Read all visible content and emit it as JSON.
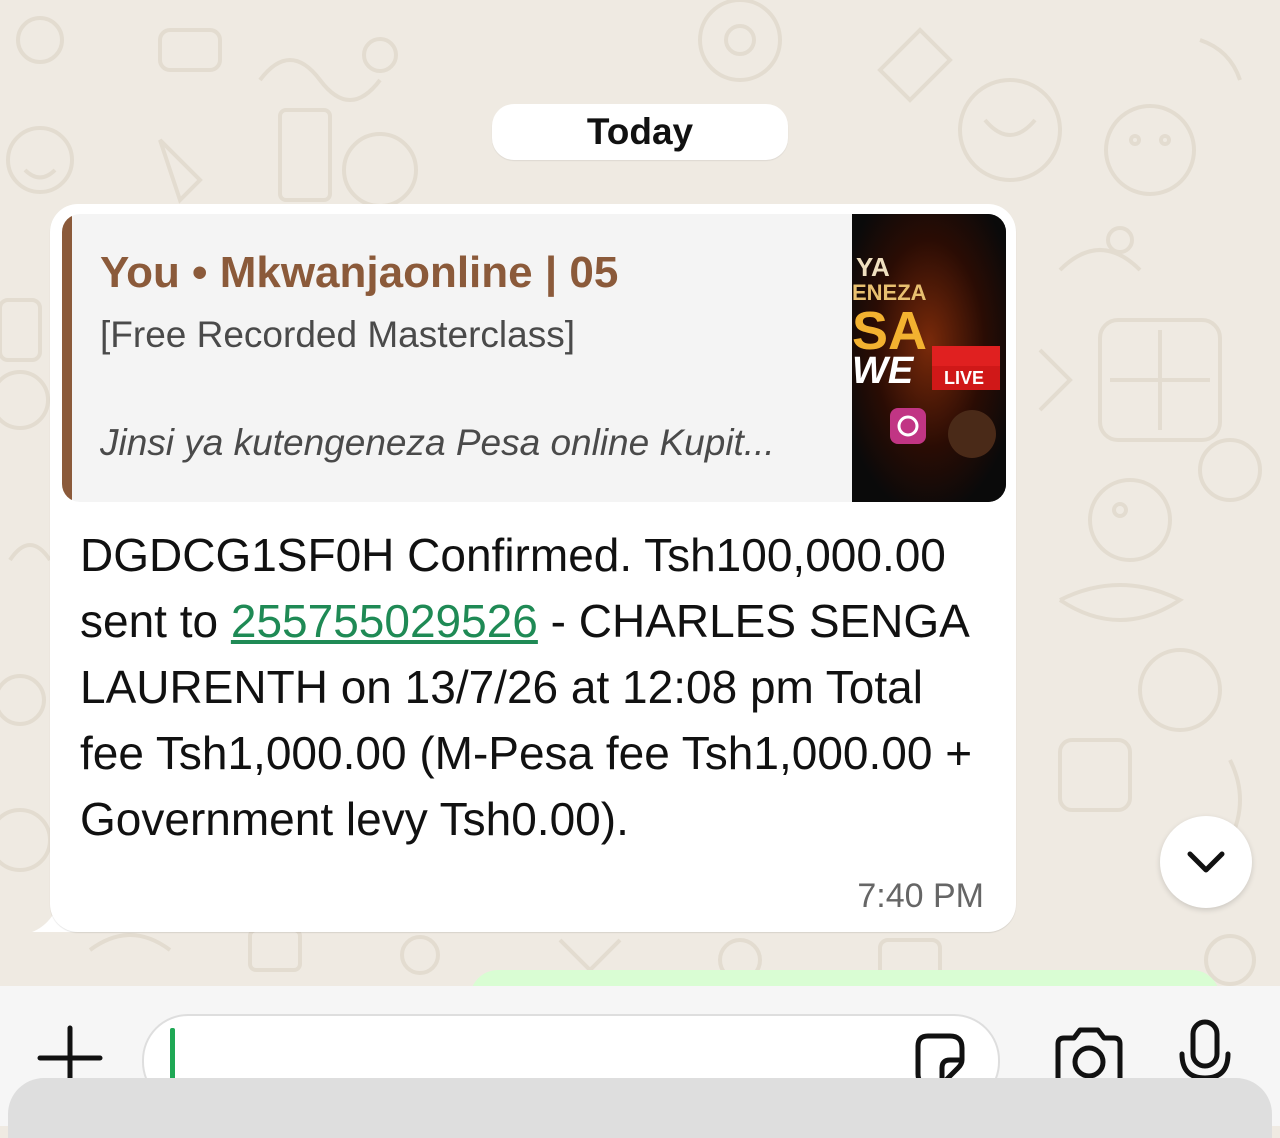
{
  "chat": {
    "date_chip": "Today"
  },
  "message": {
    "quoted": {
      "sender": "You • Mkwanjaonline | 05",
      "line1": "[Free Recorded Masterclass]",
      "line2": "Jinsi ya kutengeneza Pesa online Kupit...",
      "thumbnail_text": [
        "YA",
        "ENEZA",
        "SA",
        "WE",
        "LIVE"
      ]
    },
    "body": {
      "part1": "DGDCG1SF0H Confirmed. Tsh100,000.00 sent to ",
      "phone_link": "255755029526",
      "part2": " - CHARLES SENGA LAURENTH on 13/7/26 at 12:08 pm Total fee Tsh1,000.00 (M-Pesa fee Tsh1,000.00 + Government levy Tsh0.00)."
    },
    "time": "7:40 PM"
  },
  "icons": {
    "scroll_down": "chevron-down-icon",
    "attach": "plus-icon",
    "sticker": "sticker-icon",
    "camera": "camera-icon",
    "mic": "microphone-icon"
  },
  "colors": {
    "wallpaper": "#efeae2",
    "quote_accent": "#8b5a3a",
    "link": "#1f8a55",
    "caret": "#1fa855"
  }
}
